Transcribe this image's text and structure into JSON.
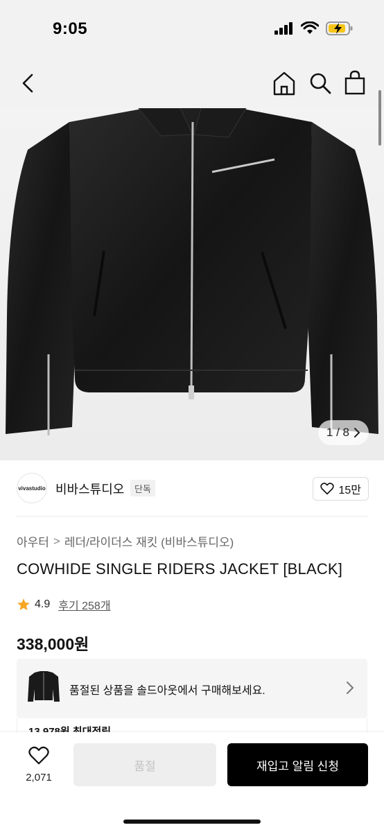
{
  "status_bar": {
    "time": "9:05"
  },
  "hero": {
    "image_counter": "1 / 8"
  },
  "brand": {
    "logo_text": "vivastudio",
    "name": "비바스튜디오",
    "badge": "단독",
    "likes": "15만"
  },
  "breadcrumb": {
    "category": "아우터",
    "subcategory": "레더/라이더스 재킷 (비바스튜디오)"
  },
  "product": {
    "title": "COWHIDE SINGLE RIDERS JACKET [BLACK]",
    "rating": "4.9",
    "reviews": "후기 258개",
    "price": "338,000원"
  },
  "soldout_notice": {
    "text": "품절된 상품을 솔드아웃에서 구매해보세요."
  },
  "points": {
    "text": "13,978원 최대적립"
  },
  "bottom_bar": {
    "wish_count": "2,071",
    "soldout_label": "품절",
    "restock_label": "재입고 알림 신청"
  },
  "icons": {
    "back": "chevron-left-icon",
    "home": "home-icon",
    "search": "search-icon",
    "bag": "shopping-bag-icon",
    "heart": "heart-icon",
    "star": "star-icon"
  },
  "colors": {
    "star": "#f5a623",
    "cta": "#000000",
    "disabled": "#eeeeee"
  }
}
